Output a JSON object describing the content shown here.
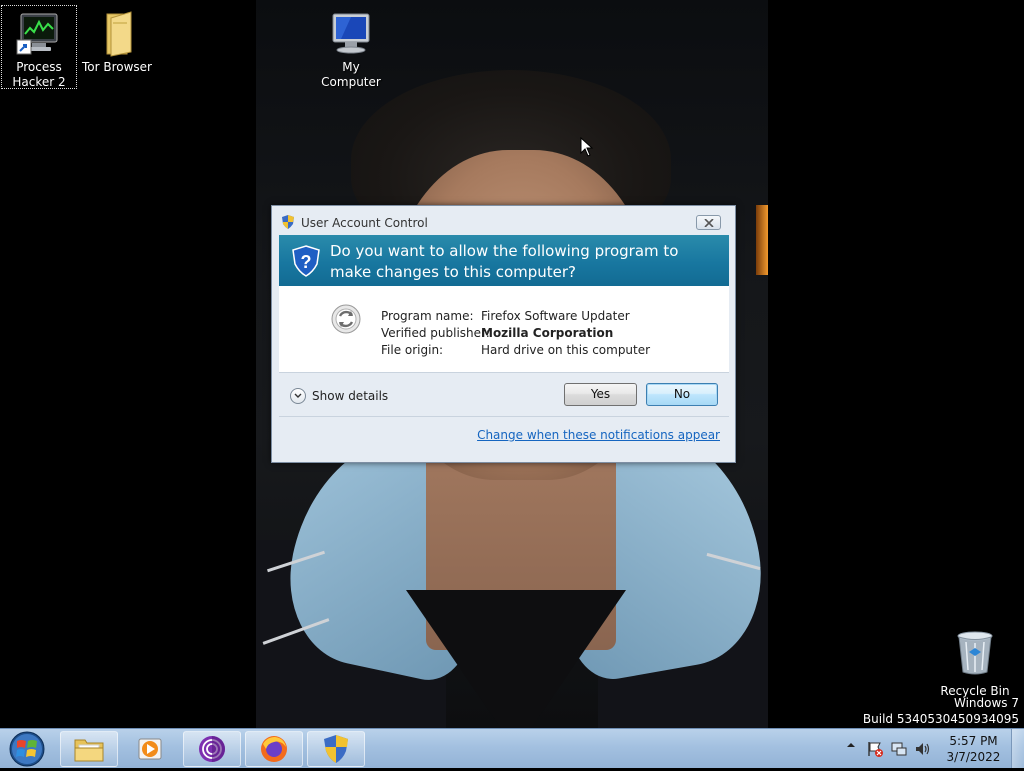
{
  "desktop": {
    "icons": [
      {
        "label": "Process Hacker 2",
        "icon": "process-hacker-icon"
      },
      {
        "label": "Tor Browser",
        "icon": "folder-icon"
      },
      {
        "label": "My Computer",
        "icon": "computer-icon"
      }
    ],
    "recycle_bin": {
      "label": "Recycle Bin",
      "icon": "recycle-bin-icon"
    },
    "watermark": {
      "line1": "Windows 7",
      "line2": "Build 5340530450934095"
    }
  },
  "uac_dialog": {
    "title": "User Account Control",
    "question": "Do you want to allow the following program to make changes to this computer?",
    "fields": [
      {
        "key": "Program name:",
        "value": "Firefox Software Updater",
        "bold": false
      },
      {
        "key": "Verified publisher:",
        "value": "Mozilla Corporation",
        "bold": true
      },
      {
        "key": "File origin:",
        "value": "Hard drive on this computer",
        "bold": false
      }
    ],
    "show_details_label": "Show details",
    "yes_label": "Yes",
    "no_label": "No",
    "link_label": "Change when these notifications appear"
  },
  "taskbar": {
    "pinned": [
      {
        "name": "explorer",
        "icon": "folder-icon"
      },
      {
        "name": "media-player",
        "icon": "media-player-icon"
      },
      {
        "name": "tor",
        "icon": "tor-icon"
      },
      {
        "name": "firefox",
        "icon": "firefox-icon"
      },
      {
        "name": "uac",
        "icon": "uac-shield-icon"
      }
    ],
    "clock": {
      "time": "5:57 PM",
      "date": "3/7/2022"
    }
  },
  "colors": {
    "banner": "#1877a0",
    "taskbar": "#a3c0e0",
    "link": "#1565c0"
  }
}
